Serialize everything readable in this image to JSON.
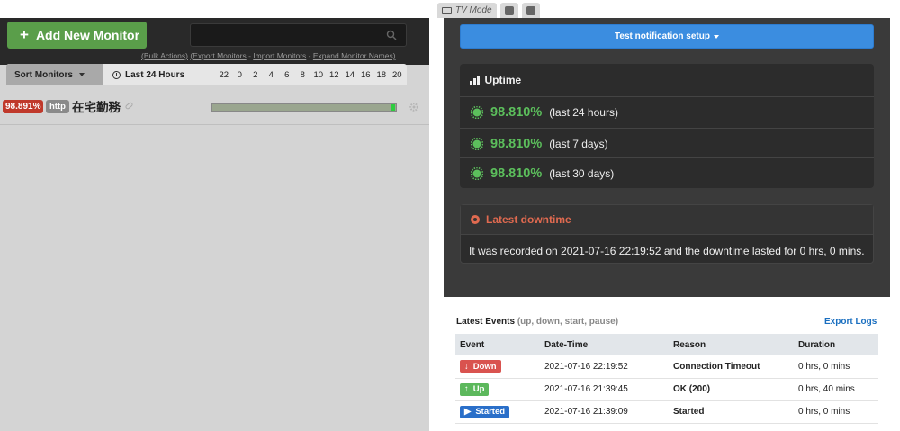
{
  "toolbar": {
    "add_label": "Add New Monitor",
    "search_placeholder": "",
    "bulk_actions": "(Bulk Actions)",
    "export_monitors": "(Export Monitors",
    "import_monitors": "Import Monitors",
    "expand_names": "Expand Monitor Names)",
    "sort_label": "Sort Monitors",
    "period_label": "Last 24 Hours",
    "hours": [
      "22",
      "0",
      "2",
      "4",
      "6",
      "8",
      "10",
      "12",
      "14",
      "16",
      "18",
      "20"
    ]
  },
  "monitor": {
    "uptime": "98.891%",
    "type": "http",
    "name": "在宅勤務"
  },
  "mode_tabs": {
    "tv_mode": "TV Mode"
  },
  "notify": {
    "label": "Test notification setup"
  },
  "uptime_card": {
    "title": "Uptime",
    "rows": [
      {
        "value": "98.810%",
        "desc": "(last 24 hours)"
      },
      {
        "value": "98.810%",
        "desc": "(last 7 days)"
      },
      {
        "value": "98.810%",
        "desc": "(last 30 days)"
      }
    ]
  },
  "downtime": {
    "title": "Latest downtime",
    "text": "It was recorded on 2021-07-16 22:19:52 and the downtime lasted for 0 hrs, 0 mins."
  },
  "events": {
    "title": "Latest Events",
    "subtitle": "(up, down, start, pause)",
    "export_label": "Export Logs",
    "headers": [
      "Event",
      "Date-Time",
      "Reason",
      "Duration"
    ],
    "rows": [
      {
        "event": "Down",
        "datetime": "2021-07-16 22:19:52",
        "reason": "Connection Timeout",
        "duration": "0 hrs, 0 mins"
      },
      {
        "event": "Up",
        "datetime": "2021-07-16 21:39:45",
        "reason": "OK (200)",
        "duration": "0 hrs, 40 mins"
      },
      {
        "event": "Started",
        "datetime": "2021-07-16 21:39:09",
        "reason": "Started",
        "duration": "0 hrs, 0 mins"
      }
    ]
  },
  "colors": {
    "accent": "#3b8de0",
    "success": "#5cb85c",
    "danger": "#d9534f",
    "add_button": "#5a9e4a"
  }
}
